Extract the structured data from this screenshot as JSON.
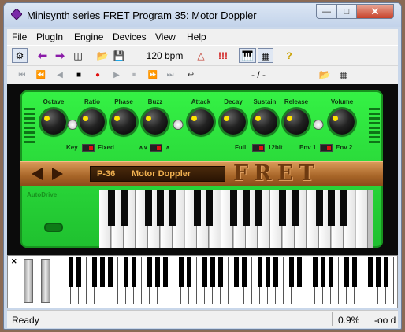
{
  "window": {
    "title": "Minisynth series FRET Program 35: Motor Doppler"
  },
  "menu": [
    "File",
    "PlugIn",
    "Engine",
    "Devices",
    "View",
    "Help"
  ],
  "toolbar": {
    "tempo": "120 bpm",
    "icons": [
      "plug-icon",
      "back-icon",
      "forward-icon",
      "windows-icon",
      "open-folder-icon",
      "save-icon",
      "metronome-icon",
      "record-marks-icon",
      "piano-icon",
      "grid-icon",
      "help-icon"
    ]
  },
  "transport": {
    "position": "- / -"
  },
  "synth": {
    "param_labels": [
      "Octave",
      "Ratio",
      "Phase",
      "Buzz",
      "Attack",
      "Decay",
      "Sustain",
      "Release",
      "Volume"
    ],
    "toggles": {
      "key": "Key",
      "fixed": "Fixed",
      "wave_a": "∧∨",
      "wave_b": "∧",
      "full": "Full",
      "bit": "12bit",
      "env1": "Env 1",
      "env2": "Env 2"
    },
    "program_number": "P-36",
    "program_name": "Motor Doppler",
    "brand": "FRET",
    "autodrive": "AutoDrive"
  },
  "status": {
    "text": "Ready",
    "cpu": "0.9%",
    "extra": "-oo d"
  },
  "colors": {
    "panel": "#2ee63e",
    "wood": "#b06a2c",
    "lcd_text": "#f0b050",
    "knob_mark": "#ffe400"
  }
}
